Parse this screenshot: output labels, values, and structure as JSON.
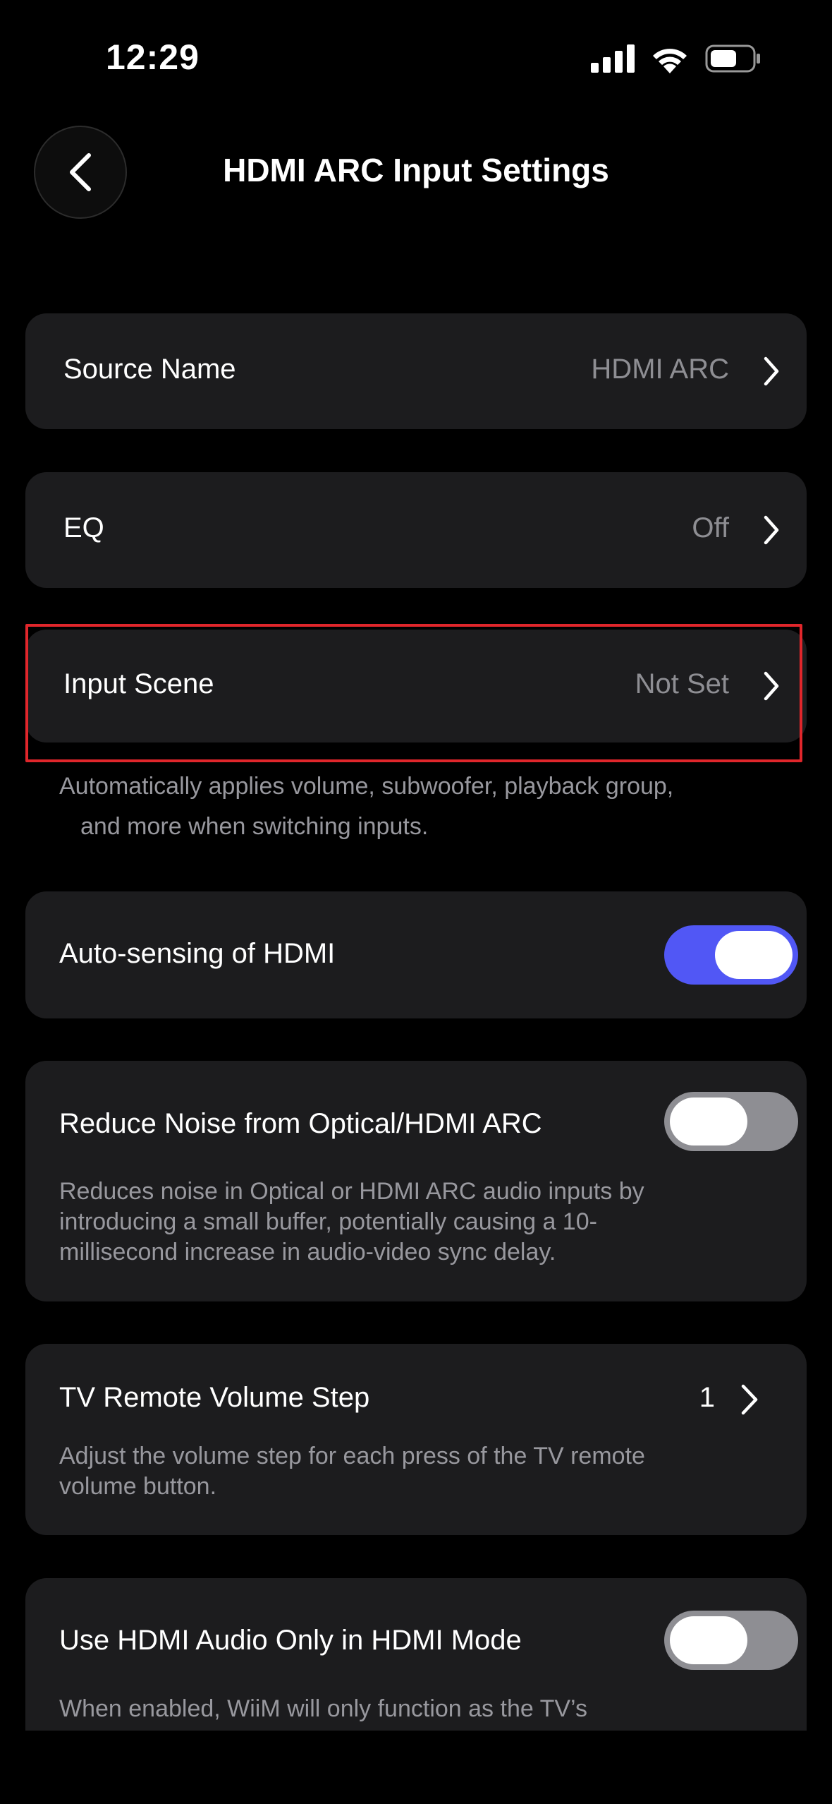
{
  "status_bar": {
    "time": "12:29"
  },
  "nav": {
    "title": "HDMI ARC Input Settings"
  },
  "rows": {
    "source_name": {
      "label": "Source Name",
      "value": "HDMI ARC"
    },
    "eq": {
      "label": "EQ",
      "value": "Off"
    },
    "input_scene": {
      "label": "Input Scene",
      "value": "Not Set",
      "description_line1": "Automatically applies volume, subwoofer, playback group,",
      "description_line2": "and more when switching inputs."
    },
    "auto_sensing": {
      "label": "Auto-sensing of HDMI",
      "enabled": true
    },
    "reduce_noise": {
      "label": "Reduce Noise from Optical/HDMI ARC",
      "enabled": false,
      "description_line1": "Reduces noise in Optical or HDMI ARC audio inputs by",
      "description_line2": "introducing a small buffer, potentially causing a 10-",
      "description_line3": "millisecond increase in audio-video sync delay."
    },
    "volume_step": {
      "label": "TV Remote Volume Step",
      "value": "1",
      "description_line1": "Adjust the volume step for each press of the TV remote",
      "description_line2": "volume button."
    },
    "hdmi_audio_only": {
      "label": "Use HDMI Audio Only in HDMI Mode",
      "enabled": false,
      "description_line1": "When enabled, WiiM will only function as the TV’s"
    }
  },
  "colors": {
    "background": "#000000",
    "card": "#1c1c1e",
    "toggle_on": "#5157f5",
    "toggle_off": "#8e8e93",
    "highlight": "#e0262b"
  },
  "icons": [
    "back-chevron-icon",
    "chevron-right-icon",
    "signal-icon",
    "wifi-icon",
    "battery-icon"
  ]
}
